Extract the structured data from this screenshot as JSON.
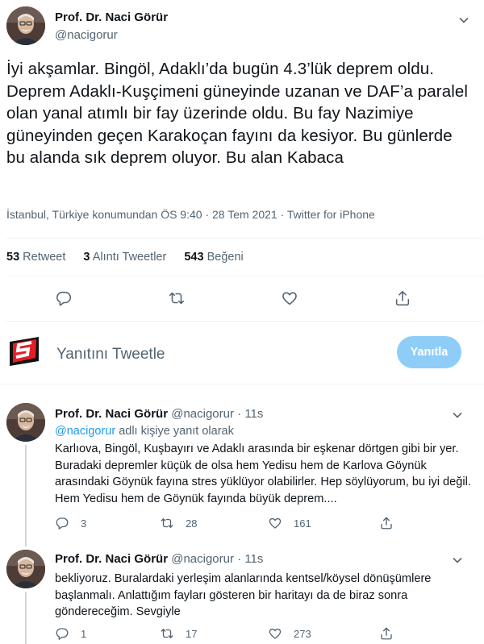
{
  "main_tweet": {
    "author_name": "Prof. Dr. Naci Görür",
    "author_handle": "@nacigorur",
    "text": "İyi akşamlar. Bingöl, Adaklı’da bugün 4.3’lük deprem oldu. Deprem Adaklı-Kuşçimeni güneyinde uzanan ve DAF’a paralel olan yanal atımlı bir fay üzerinde oldu. Bu fay Nazimiye güneyinden geçen Karakoçan fayını da kesiyor. Bu günlerde bu alanda sık deprem oluyor. Bu alan Kabaca",
    "meta": "İstanbul, Türkiye konumundan ÖS 9:40 · 28 Tem 2021 · Twitter for iPhone",
    "stats": {
      "retweet_count": "53",
      "retweet_label": "Retweet",
      "quote_count": "3",
      "quote_label": "Alıntı Tweetler",
      "like_count": "543",
      "like_label": "Beğeni"
    }
  },
  "reply_box": {
    "placeholder": "Yanıtını Tweetle",
    "button_label": "Yanıtla"
  },
  "replies": [
    {
      "author_name": "Prof. Dr. Naci Görür",
      "author_handle": "@nacigorur",
      "separator": "·",
      "time": "11s",
      "reply_to_handle": "@nacigorur",
      "reply_to_suffix": "adlı kişiye yanıt olarak",
      "text": "Karlıova, Bingöl, Kuşbayırı ve Adaklı arasında bir eşkenar dörtgen gibi bir yer. Buradaki depremler küçük de olsa hem Yedisu hem de Karlova Göynük arasındaki Göynük fayına stres yüklüyor olabilirler. Hep söylüyorum, bu iyi değil. Hem Yedisu hem de Göynük fayında büyük deprem....",
      "reply_count": "3",
      "retweet_count": "28",
      "like_count": "161"
    },
    {
      "author_name": "Prof. Dr. Naci Görür",
      "author_handle": "@nacigorur",
      "separator": "·",
      "time": "11s",
      "text": "bekliyoruz. Buralardaki yerleşim alanlarında kentsel/köysel dönüşümlere başlanmalı. Anlattığım fayları gösteren bir haritayı da de biraz sonra göndereceğim. Sevgiyle",
      "reply_count": "1",
      "retweet_count": "17",
      "like_count": "273"
    }
  ],
  "colors": {
    "accent": "#1d9bf0",
    "button_disabled": "#8ecdf8",
    "secondary_text": "#536471",
    "divider": "#eff3f4"
  },
  "icons": [
    "reply-icon",
    "retweet-icon",
    "like-icon",
    "share-icon",
    "caret-down-icon",
    "avatar",
    "brand-logo"
  ]
}
